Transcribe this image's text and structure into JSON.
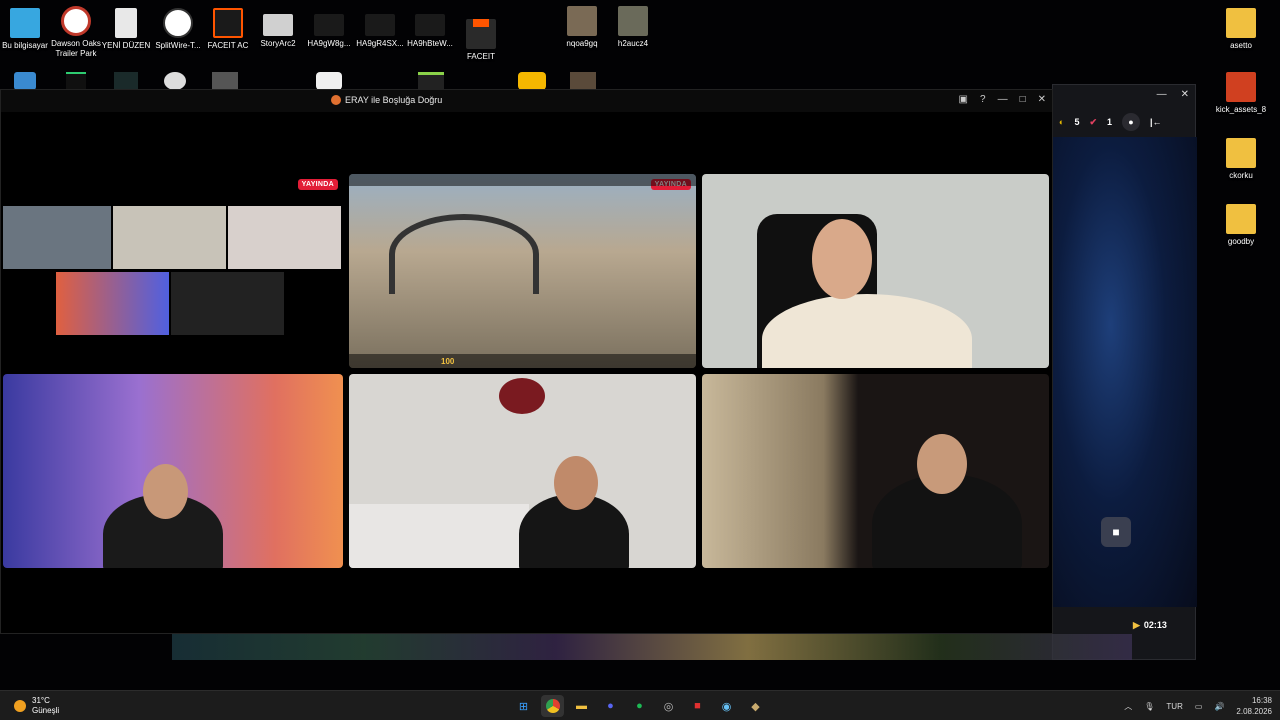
{
  "desktop_icons_top": [
    {
      "label": "Bu bilgisayar",
      "color": "#37a7e0"
    },
    {
      "label": "Dawson Oaks Trailer Park",
      "color": "#c0392b"
    },
    {
      "label": "YENİ DÜZEN",
      "color": "#e8e8e8"
    },
    {
      "label": "SplitWire-T...",
      "color": "#ffffff"
    },
    {
      "label": "FACEIT AC",
      "color": "#ff5500"
    },
    {
      "label": "StoryArc2",
      "color": "#d0d0d0"
    },
    {
      "label": "HA9gW8g...",
      "color": "#1a1a1a"
    },
    {
      "label": "HA9gR4SX...",
      "color": "#1a1a1a"
    },
    {
      "label": "HA9hBteW...",
      "color": "#1a1a1a"
    },
    {
      "label": "FACEIT",
      "color": "#ff5500"
    },
    {
      "label": "nqoa9gq",
      "color": "#7a6a55"
    },
    {
      "label": "h2aucz4",
      "color": "#6a6a5a"
    }
  ],
  "desktop_icons_right": [
    {
      "label": "asetto",
      "color": "#f0c040"
    },
    {
      "label": "kick_assets_8",
      "color": "#d04020"
    },
    {
      "label": "ckorku",
      "color": "#f0c040"
    },
    {
      "label": "goodby",
      "color": "#f0c040"
    }
  ],
  "bg_window": {
    "coin_count": "5",
    "rank_count": "1",
    "timer": "02:13"
  },
  "main_window": {
    "title": "ERAY ile Boşluğa Doğru"
  },
  "tiles": {
    "live_label": "YAYINDA",
    "hud_health": "100"
  },
  "taskbar": {
    "temperature": "31°C",
    "weather": "Güneşli",
    "language": "TUR",
    "time": "16:38",
    "date": "2.08.2026"
  }
}
